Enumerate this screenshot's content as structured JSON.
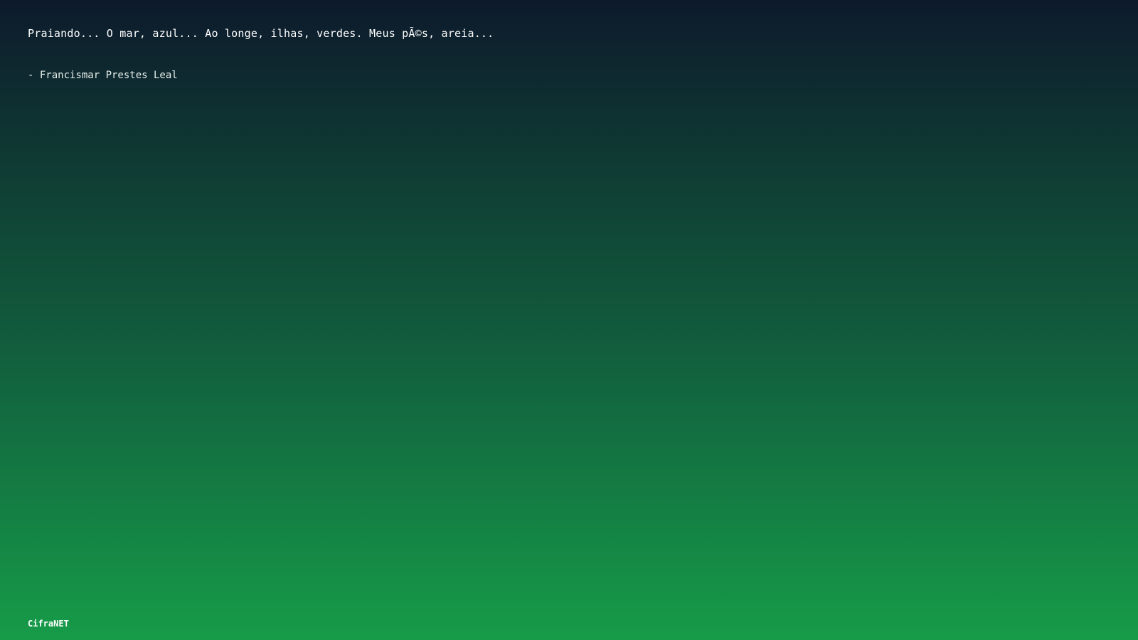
{
  "quote": {
    "text": "Praiando... O mar, azul... Ao longe, ilhas, verdes. Meus pÃ©s, areia...",
    "author": "- Francismar Prestes Leal"
  },
  "footer": {
    "brand": "CifraNET"
  },
  "colors": {
    "gradient_top": "#0d1a2c",
    "gradient_bottom": "#169b48",
    "text": "#ffffff"
  }
}
